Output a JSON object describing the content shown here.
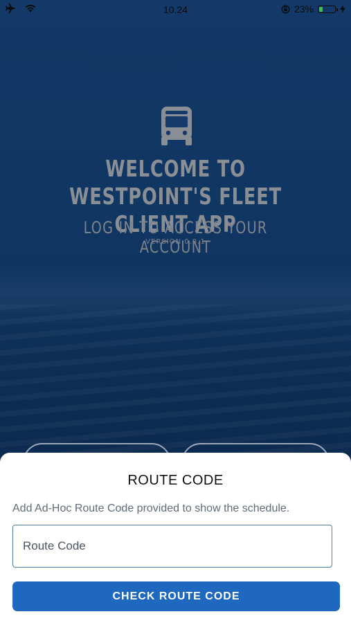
{
  "status_bar": {
    "time": "10.24",
    "battery_percent": "23%",
    "battery_level": 0.23,
    "icons": [
      "airplane-mode-icon",
      "wifi-icon",
      "orientation-lock-icon",
      "battery-icon",
      "charging-icon"
    ]
  },
  "hero": {
    "icon": "bus-icon",
    "title": "WELCOME TO WESTPOINT'S FLEET CLIENT APP",
    "subtitle": "LOG IN TO ACCESS YOUR ACCOUNT",
    "version": "VERSION 0.0.1"
  },
  "sheet": {
    "title": "ROUTE CODE",
    "description": "Add Ad-Hoc Route Code provided to show the schedule.",
    "input_placeholder": "Route Code",
    "button_label": "CHECK ROUTE CODE"
  },
  "colors": {
    "background": "#103561",
    "primary_button": "#1e68c0",
    "input_border": "#4b7fb0",
    "battery_fill": "#3dc43d"
  }
}
